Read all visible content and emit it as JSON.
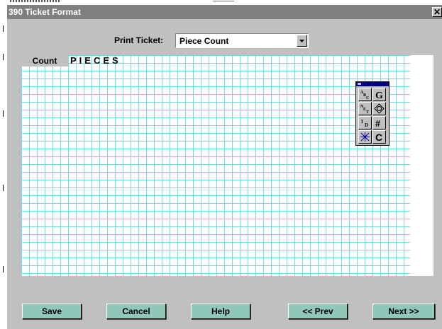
{
  "window": {
    "title": "390 Ticket Format",
    "close_glyph": "✕"
  },
  "print_ticket": {
    "label": "Print Ticket:",
    "value": "Piece Count",
    "dropdown_icon": "chevron-down-icon"
  },
  "grid": {
    "field_label": "Count",
    "field_text": "PIECES"
  },
  "toolbox": {
    "tools": [
      {
        "name": "text-abc-tool",
        "icon": "abc-text-icon"
      },
      {
        "name": "graphic-g-tool",
        "icon": "g-graphic-icon"
      },
      {
        "name": "net-tool",
        "icon": "net-icon"
      },
      {
        "name": "weight-diamond-tool",
        "icon": "diamond-icon"
      },
      {
        "name": "id-tool",
        "icon": "id-icon"
      },
      {
        "name": "number-tool",
        "icon": "hash-icon"
      },
      {
        "name": "sparkle-tool",
        "icon": "sparkle-icon"
      },
      {
        "name": "c-tool",
        "icon": "c-icon"
      }
    ]
  },
  "buttons": {
    "save": "Save",
    "cancel": "Cancel",
    "help": "Help",
    "prev": "<< Prev",
    "next": "Next >>"
  },
  "colors": {
    "button_face": "#8fc7b8",
    "grid_line": "#6fe0e0",
    "title_bar": "#808080",
    "toolbox_title": "#000080"
  }
}
